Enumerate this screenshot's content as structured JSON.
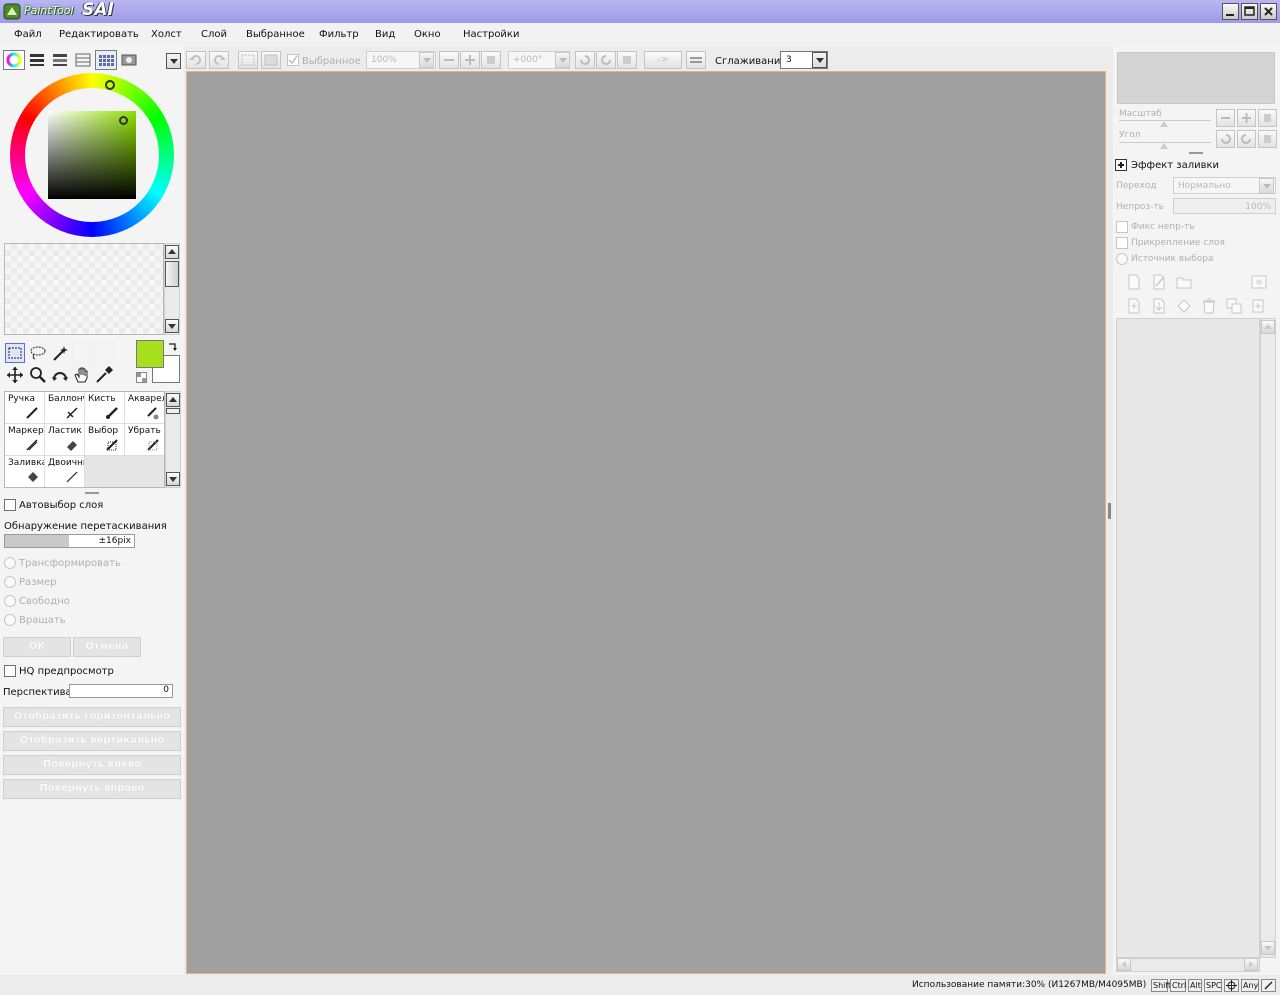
{
  "app": {
    "logo_small": "PaintTool",
    "logo_big": "SAI"
  },
  "menu": [
    "Файл",
    "Редактировать",
    "Холст",
    "Слой",
    "Выбранное",
    "Фильтр",
    "Вид",
    "Окно",
    "Настройки"
  ],
  "toolbar": {
    "selection_label": "Выбранное",
    "zoom_value": "100%",
    "angle_value": "+000°",
    "flip_label": "->",
    "smoothing_label": "Сглаживание",
    "smoothing_value": "3"
  },
  "color": {
    "current": "#a6e01c",
    "secondary": "#ffffff",
    "accent_canvas_border": "#e7b27a",
    "canvas_bg": "#a0a0a0"
  },
  "tools": [
    {
      "label": "Ручка",
      "icon": "pen-icon"
    },
    {
      "label": "Баллончик",
      "icon": "airbrush-icon"
    },
    {
      "label": "Кисть",
      "icon": "brush-icon"
    },
    {
      "label": "Акварель",
      "icon": "watercolor-icon"
    },
    {
      "label": "Маркер",
      "icon": "marker-icon"
    },
    {
      "label": "Ластик",
      "icon": "eraser-icon"
    },
    {
      "label": "Выбор",
      "icon": "select-pen-icon"
    },
    {
      "label": "Убрать",
      "icon": "deselect-pen-icon"
    },
    {
      "label": "Заливка",
      "icon": "bucket-icon"
    },
    {
      "label": "Двоичный",
      "icon": "binary-pen-icon"
    }
  ],
  "options": {
    "auto_select_layer": "Автовыбор слоя",
    "drag_detection": "Обнаружение перетаскивания",
    "drag_value": "±16pix",
    "transform_modes": [
      "Трансформировать",
      "Размер",
      "Свободно",
      "Вращать"
    ],
    "ok": "OK",
    "cancel": "Отмена",
    "hq_preview": "HQ предпросмотр",
    "perspective_label": "Перспектива",
    "perspective_value": "0",
    "actions": [
      "Отобразить горизонтально",
      "Отобразить вертикально",
      "Повернуть влево",
      "Повернуть вправо"
    ]
  },
  "navigator": {
    "scale_label": "Масштаб",
    "angle_label": "Угол"
  },
  "layer_panel": {
    "fill_effect": "Эффект заливки",
    "blend_label": "Переход",
    "blend_value": "Нормально",
    "opacity_label": "Непроз-ть",
    "opacity_value": "100%",
    "options": [
      "Фикс непр-ть",
      "Прикрепление слоя",
      "Источник выбора"
    ]
  },
  "status": {
    "memory": "Использование памяти:30% (И1267MB/M4095MB)",
    "keys": [
      "Shift",
      "Ctrl",
      "Alt",
      "SPC",
      "Any"
    ]
  }
}
